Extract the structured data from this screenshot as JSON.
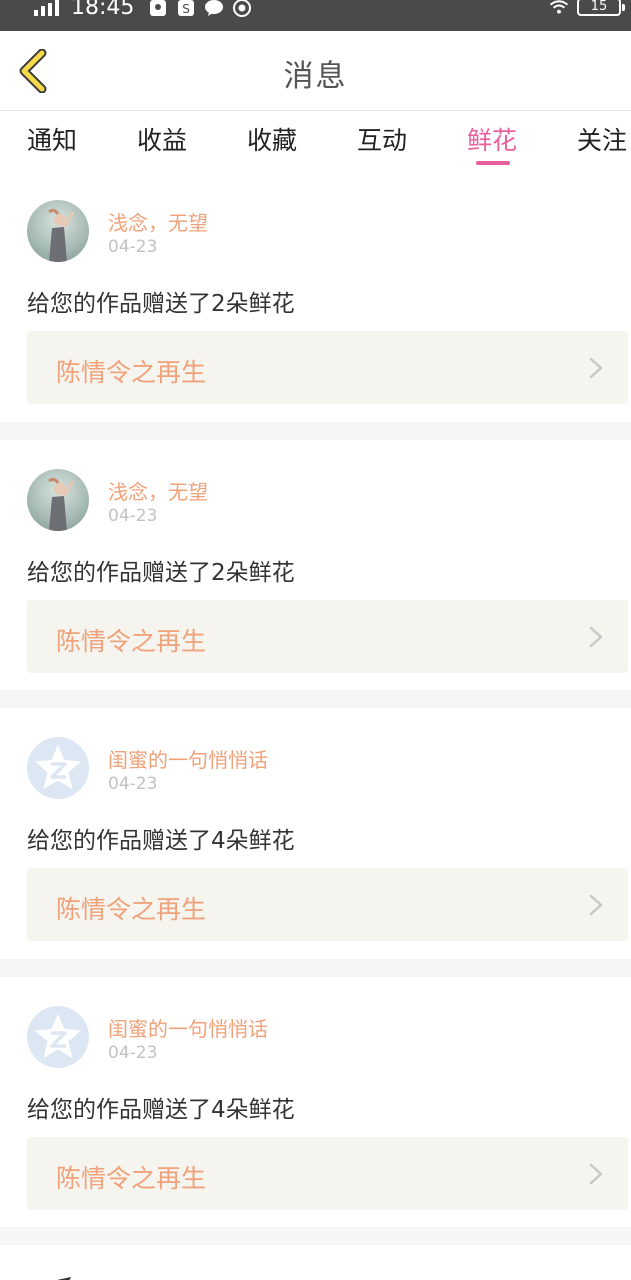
{
  "status_bar": {
    "time": "18:45",
    "battery": "15"
  },
  "header": {
    "title": "消息",
    "back_icon": "chevron-left-icon"
  },
  "tabs": [
    {
      "label": "通知",
      "active": false
    },
    {
      "label": "收益",
      "active": false
    },
    {
      "label": "收藏",
      "active": false
    },
    {
      "label": "互动",
      "active": false
    },
    {
      "label": "鲜花",
      "active": true
    },
    {
      "label": "关注",
      "active": false
    }
  ],
  "colors": {
    "accent": "#e8609c",
    "username": "#f0a27a",
    "card_bg": "#f5f4ef",
    "separator": "#f7f5f5"
  },
  "messages": [
    {
      "username": "浅念，无望",
      "date": "04-23",
      "text": "给您的作品赠送了2朵鲜花",
      "work_title": "陈情令之再生",
      "avatar": "photo"
    },
    {
      "username": "浅念，无望",
      "date": "04-23",
      "text": "给您的作品赠送了2朵鲜花",
      "work_title": "陈情令之再生",
      "avatar": "photo"
    },
    {
      "username": "闺蜜的一句悄悄话",
      "date": "04-23",
      "text": "给您的作品赠送了4朵鲜花",
      "work_title": "陈情令之再生",
      "avatar": "default"
    },
    {
      "username": "闺蜜的一句悄悄话",
      "date": "04-23",
      "text": "给您的作品赠送了4朵鲜花",
      "work_title": "陈情令之再生",
      "avatar": "default"
    }
  ]
}
